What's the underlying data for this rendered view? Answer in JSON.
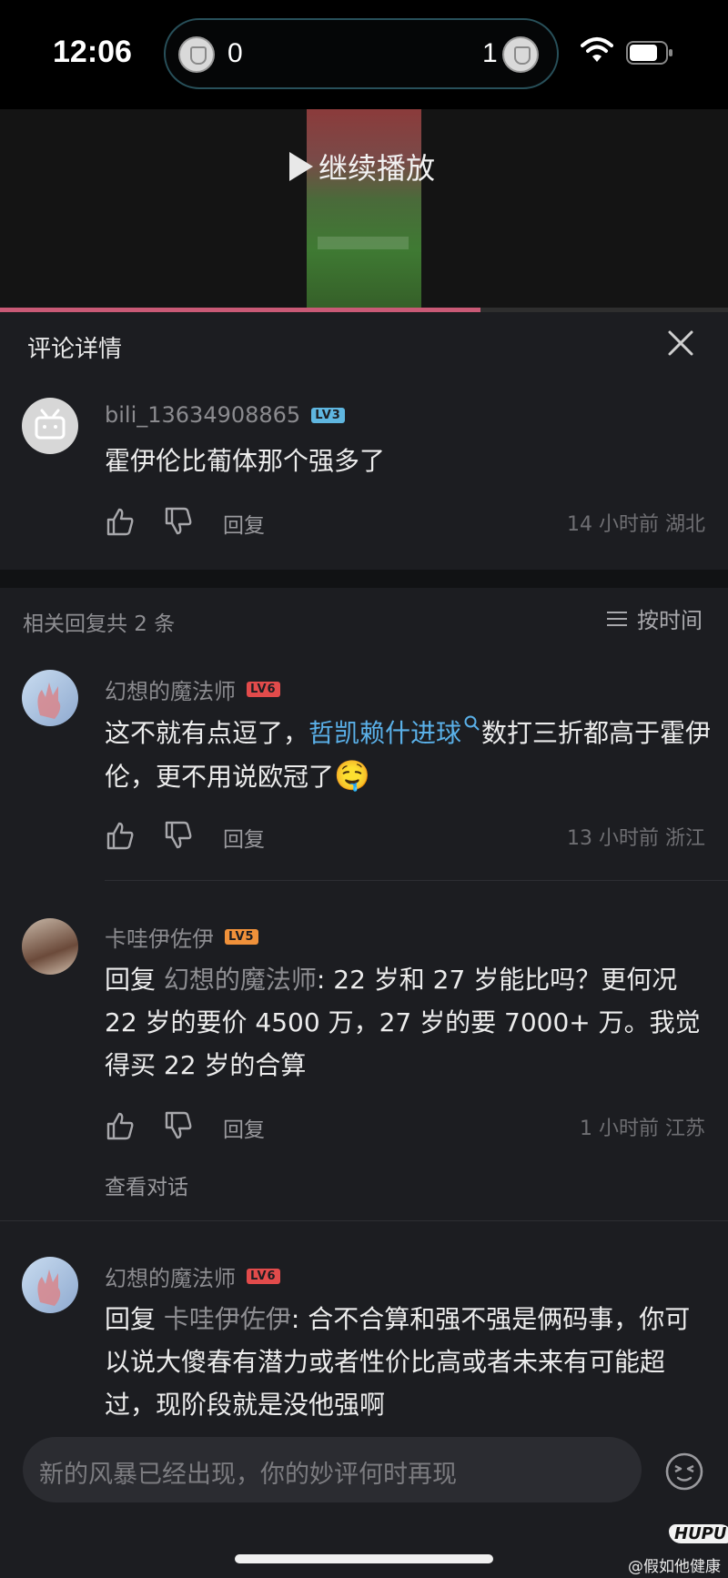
{
  "status_bar": {
    "time": "12:06",
    "score_left": "0",
    "score_right": "1",
    "wifi_icon": "wifi-icon",
    "battery_icon": "battery-icon"
  },
  "video": {
    "resume_label": "继续播放",
    "progress": 0.66
  },
  "panel": {
    "title": "评论详情",
    "close_icon": "close-icon"
  },
  "main_comment": {
    "username": "bili_13634908865",
    "level": "LV3",
    "text": "霍伊伦比葡体那个强多了",
    "reply_label": "回复",
    "meta": "14 小时前 湖北"
  },
  "replies_header": {
    "count_text": "相关回复共 2 条",
    "sort_label": "按时间"
  },
  "replies": [
    {
      "username": "幻想的魔法师",
      "level": "LV6",
      "text_before": "这不就有点逗了，",
      "link_text": "哲凯赖什进球",
      "text_after": "数打三折都高于霍伊伦，更不用说欧冠了",
      "emoji": "🤤",
      "reply_label": "回复",
      "meta": "13 小时前 浙江"
    },
    {
      "username": "卡哇伊佐伊",
      "level": "LV5",
      "reply_prefix": "回复 ",
      "reply_to": "幻想的魔法师",
      "text": ": 22 岁和 27 岁能比吗？更何况 22 岁的要价 4500 万，27 岁的要 7000+ 万。我觉得买 22 岁的合算",
      "reply_label": "回复",
      "meta": "1 小时前 江苏",
      "view_conversation": "查看对话"
    },
    {
      "username": "幻想的魔法师",
      "level": "LV6",
      "reply_prefix": "回复 ",
      "reply_to": "卡哇伊佐伊",
      "text": ": 合不合算和强不强是俩码事，你可以说大傻春有潜力或者性价比高或者未来有可能超过，现阶段就是没他强啊"
    }
  ],
  "input": {
    "placeholder": "新的风暴已经出现，你的妙评何时再现",
    "emoji_icon": "emoji-icon"
  },
  "watermark": {
    "logo": "HUPU",
    "text": "@假如他健康"
  },
  "colors": {
    "background": "#1c1d21",
    "link": "#5ab0e8",
    "progress": "#c95a76",
    "lv3": "#5fb6e0",
    "lv5": "#f0913a",
    "lv6": "#e24b4b"
  }
}
